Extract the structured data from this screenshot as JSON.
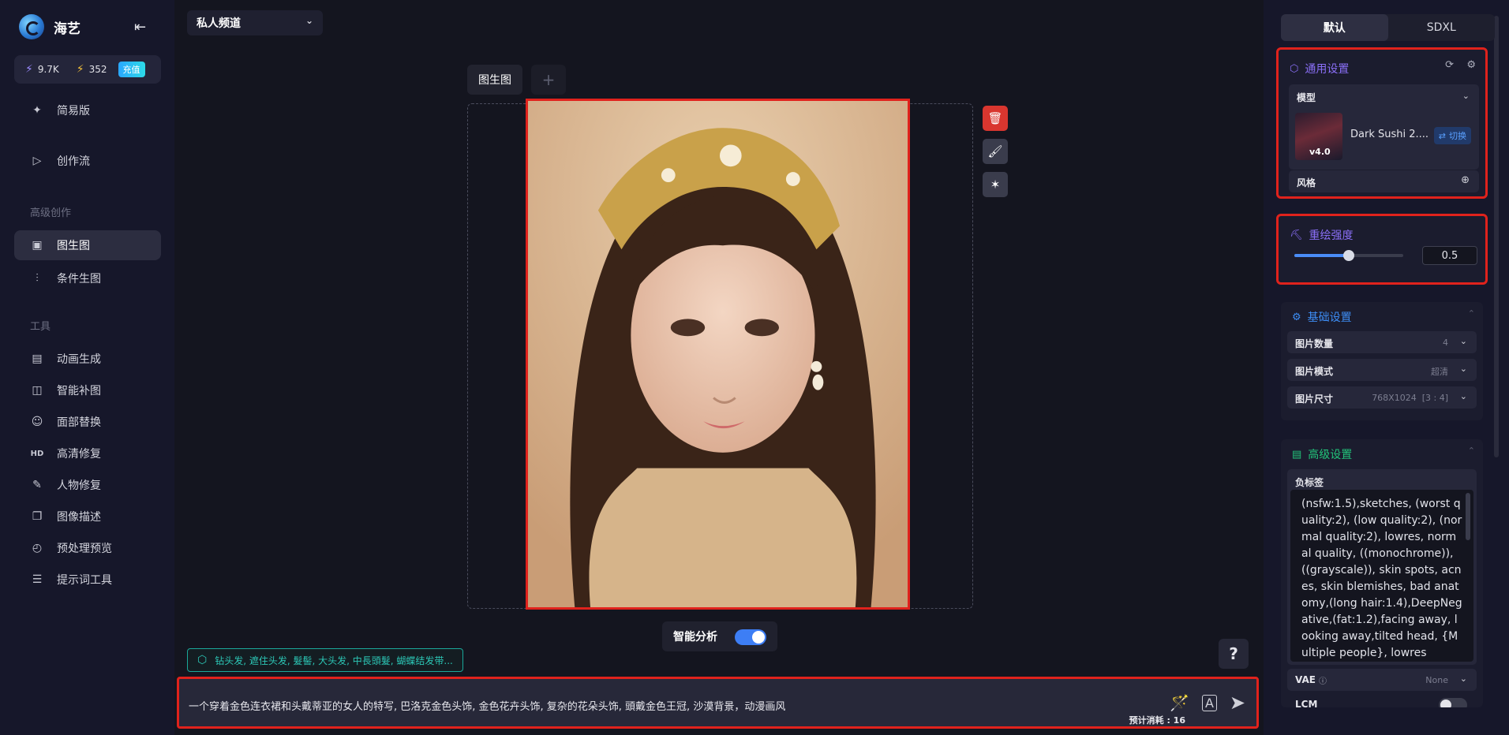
{
  "app": {
    "name": "海艺"
  },
  "credits": {
    "energy": "9.7K",
    "lightning": "352",
    "recharge_label": "充值"
  },
  "sidebar": {
    "items_top": [
      {
        "label": "简易版",
        "icon": "sparkle-icon"
      },
      {
        "label": "创作流",
        "icon": "play-icon"
      }
    ],
    "section_advanced": "高级创作",
    "items_advanced": [
      {
        "label": "图生图",
        "icon": "image-icon"
      },
      {
        "label": "条件生图",
        "icon": "sliders-icon"
      }
    ],
    "section_tools": "工具",
    "items_tools": [
      {
        "label": "动画生成",
        "icon": "film-icon"
      },
      {
        "label": "智能补图",
        "icon": "expand-image-icon"
      },
      {
        "label": "面部替换",
        "icon": "face-icon"
      },
      {
        "label": "高清修复",
        "icon": "hd-icon"
      },
      {
        "label": "人物修复",
        "icon": "repair-icon"
      },
      {
        "label": "图像描述",
        "icon": "book-icon"
      },
      {
        "label": "预处理预览",
        "icon": "preview-icon"
      },
      {
        "label": "提示词工具",
        "icon": "prompt-icon"
      }
    ]
  },
  "header": {
    "channel": "私人频道"
  },
  "canvas": {
    "tab_label": "图生图",
    "add_tab": "+"
  },
  "smart_analysis": {
    "label": "智能分析",
    "enabled": true
  },
  "tag_hint": "钻头发, 遮住头发, 髮髻, 大头发, 中長頭髮, 蝴蝶结发带...",
  "prompt": {
    "text": "一个穿着金色连衣裙和头戴蒂亚的女人的特写, 巴洛克金色头饰, 金色花卉头饰, 复杂的花朵头饰, 頭戴金色王冠, 沙漠背景，动漫画风",
    "cost": "预计消耗 : 16"
  },
  "help": "?",
  "right_panel": {
    "tabs": [
      "默认",
      "SDXL"
    ],
    "general": {
      "title": "通用设置",
      "model_label": "模型",
      "model_name": "Dark Sushi 2....",
      "model_badge": "v4.0",
      "switch_label": "切换",
      "style_label": "风格"
    },
    "redraw": {
      "title": "重绘强度",
      "value": "0.5",
      "fraction": 0.5
    },
    "basic": {
      "title": "基础设置",
      "rows": [
        {
          "label": "图片数量",
          "value": "4"
        },
        {
          "label": "图片模式",
          "value": "超清"
        },
        {
          "label": "图片尺寸",
          "value": "768X1024  [3 : 4]"
        }
      ]
    },
    "advanced": {
      "title": "高级设置",
      "neg_label": "负标签",
      "neg_text": "(nsfw:1.5),sketches, (worst quality:2), (low quality:2), (normal quality:2), lowres, normal quality, ((monochrome)), ((grayscale)), skin spots, acnes, skin blemishes, bad anatomy,(long hair:1.4),DeepNegative,(fat:1.2),facing away, looking away,tilted head, {Multiple people}, lowres",
      "vae_label": "VAE",
      "vae_value": "None",
      "lcm_label": "LCM"
    }
  },
  "colors": {
    "accent_blue": "#3d7ef5",
    "highlight_red": "#e0221c",
    "teal": "#2cc7b6",
    "purple": "#8a6ff7"
  }
}
